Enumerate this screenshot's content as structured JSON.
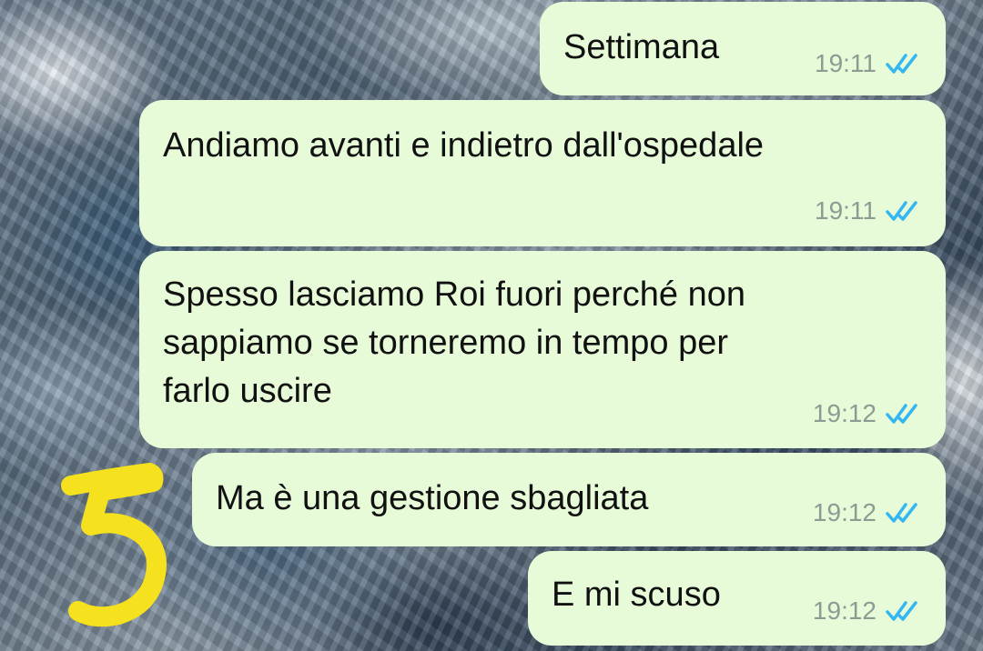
{
  "chat": {
    "accent_color": "#34b7f1",
    "bubble_color": "#e7fbd9",
    "messages": [
      {
        "text": "Settimana",
        "time": "19:11",
        "status_icon": "double-check-read-icon"
      },
      {
        "text": "Andiamo avanti e indietro dall'ospedale",
        "time": "19:11",
        "status_icon": "double-check-read-icon"
      },
      {
        "text": "Spesso lasciamo Roi fuori perché non\nsappiamo se torneremo in tempo per\nfarlo uscire",
        "time": "19:12",
        "status_icon": "double-check-read-icon"
      },
      {
        "text": "Ma è una gestione sbagliata",
        "time": "19:12",
        "status_icon": "double-check-read-icon"
      },
      {
        "text": "E mi scuso",
        "time": "19:12",
        "status_icon": "double-check-read-icon"
      }
    ]
  },
  "annotation": {
    "text": "5",
    "color": "#f5e11d"
  }
}
